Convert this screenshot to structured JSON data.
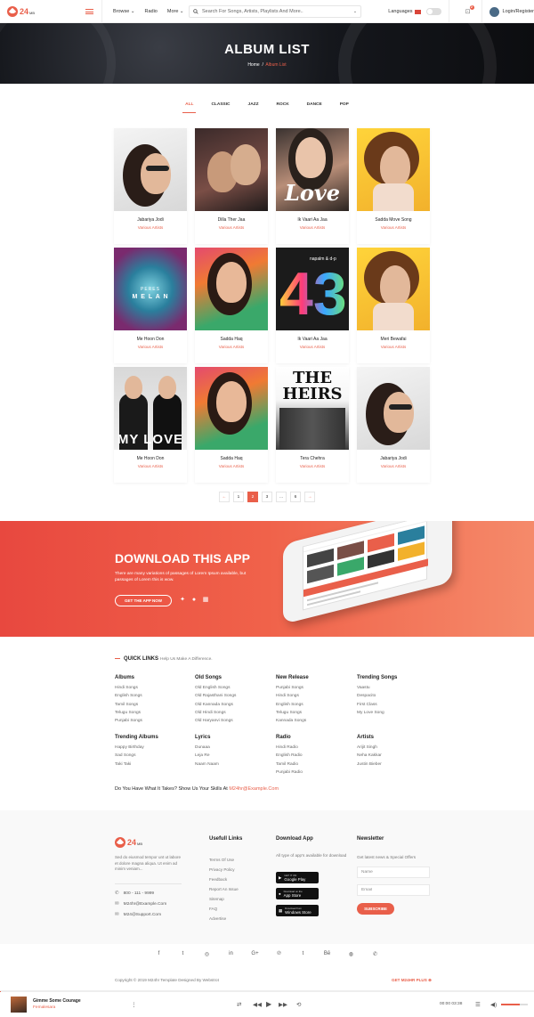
{
  "header": {
    "logo_num": "24",
    "logo_sub": "MB",
    "nav": [
      "Browse ⌄",
      "Radio",
      "More ⌄"
    ],
    "search_placeholder": "Search For Songs, Artists, Playlists And More..",
    "languages": "Languages",
    "notifications": "2",
    "login": "Login/Register"
  },
  "hero": {
    "title": "ALBUM LIST",
    "crumb_home": "Home",
    "crumb_sep": "/",
    "crumb_current": "Album List"
  },
  "tabs": [
    "ALL",
    "CLASSIC",
    "JAZZ",
    "ROCK",
    "DANCE",
    "POP"
  ],
  "albums": [
    {
      "title": "Jabariya Jodi",
      "artist": "Various Artists"
    },
    {
      "title": "Dilla Ther Jaa",
      "artist": "Various Artists"
    },
    {
      "title": "Ik Vaari Aa Jaa",
      "artist": "Various Artists"
    },
    {
      "title": "Sadda Move Song",
      "artist": "Various Artists"
    },
    {
      "title": "Me Hoon Don",
      "artist": "Various Artists"
    },
    {
      "title": "Sadda Haq",
      "artist": "Various Artists"
    },
    {
      "title": "Ik Vaari Aa Jaa",
      "artist": "Various Artists"
    },
    {
      "title": "Meri Bewafai",
      "artist": "Various Artists"
    },
    {
      "title": "Me Hoon Don",
      "artist": "Various Artists"
    },
    {
      "title": "Sadda Haq",
      "artist": "Various Artists"
    },
    {
      "title": "Tera Chehra",
      "artist": "Various Artists"
    },
    {
      "title": "Jabariya Jodi",
      "artist": "Various Artists"
    }
  ],
  "cover_text": {
    "love": "Love",
    "peres": "PERES",
    "melan": "M E L A N",
    "napalm": "napalm & d-p",
    "n43": "43",
    "heirs": "THE HEIRS",
    "mylove": "MY LOVE"
  },
  "pagination": {
    "prev": "←",
    "pages": [
      "1",
      "2",
      "3",
      "...",
      "6"
    ],
    "next": "→",
    "current": "2"
  },
  "app": {
    "title": "DOWNLOAD THIS APP",
    "desc": "There are many variations of passages of Lorem Ipsum available, but passages of Lorem this is wow.",
    "button": "GET THE APP NOW"
  },
  "quick_links": {
    "title": "QUICK LINKS",
    "hint": "Help Us Make A Difference.",
    "columns": [
      {
        "title": "Albums",
        "items": [
          "Hindi Songs",
          "English Songs",
          "Tamil Songs",
          "Telugu Songs",
          "Punjabi Songs"
        ]
      },
      {
        "title": "Old Songs",
        "items": [
          "Old English Songs",
          "Old Rajasthani Songs",
          "Old Kannada Songs",
          "Old Hindi Songs",
          "Old Haryanvi Songs"
        ]
      },
      {
        "title": "New Release",
        "items": [
          "Punjabi Songs",
          "Hindi Songs",
          "English Songs",
          "Telugu Songs",
          "Kannada Songs"
        ]
      },
      {
        "title": "Trending Songs",
        "items": [
          "Vaastu",
          "Despacito",
          "First Class",
          "My Love Song"
        ]
      },
      {
        "title": "Trending Albums",
        "items": [
          "Happy Birthday",
          "Sad Songs",
          "Taki Taki"
        ]
      },
      {
        "title": "Lyrics",
        "items": [
          "Dunaaa",
          "Leja Re",
          "Naam Naam"
        ]
      },
      {
        "title": "Radio",
        "items": [
          "Hindi Radio",
          "English Radio",
          "Tamil Radio",
          "Punjabi Radio"
        ]
      },
      {
        "title": "Artists",
        "items": [
          "Arijit Singh",
          "Neha Kakkar",
          "Justin Bieber"
        ]
      }
    ],
    "cta": "Do You Have What It Takes? Show Us Your Skills At ",
    "cta_email": "M24hr@Example.Com"
  },
  "footer": {
    "about": "Sed do eiusmod tempor unt ut labore et dolore magna aliqua. Ut enim ad minim veniam...",
    "phone": "800 - 111 - 9999",
    "email": "M24hr@Example.Com",
    "support": "M24@Support.Com",
    "useful_title": "Usefull Links",
    "useful": [
      "Terms Of Use",
      "Privacy Policy",
      "Feedback",
      "Report An Issue",
      "Sitemap",
      "FAQ",
      "Advertise"
    ],
    "download_title": "Download App",
    "download_text": "All type of app's available for download",
    "stores": [
      {
        "small": "GET IT ON",
        "name": "Google Play"
      },
      {
        "small": "Download on the",
        "name": "App Store"
      },
      {
        "small": "Download from",
        "name": "Windows Store"
      }
    ],
    "newsletter_title": "Newsletter",
    "newsletter_text": "Get latest news & Special Offers",
    "name_placeholder": "Name",
    "email_placeholder": "Email",
    "subscribe": "SUBSCRIBE"
  },
  "social": [
    "f",
    "t",
    "◎",
    "in",
    "G+",
    "℗",
    "t",
    "Bē",
    "◍",
    "✆"
  ],
  "bottom": {
    "copyright": "Copyright © 2019 M24hr Template Designed By Webstrot",
    "get": "GET M24HR PLUS ⊕"
  },
  "player": {
    "song": "Gimme Some Courage",
    "artist": "Femalesara",
    "time": "00:00",
    "duration": "03:38",
    "progress": 0.002,
    "volume": 0.7
  },
  "colors": {
    "accent": "#e95f4a"
  }
}
